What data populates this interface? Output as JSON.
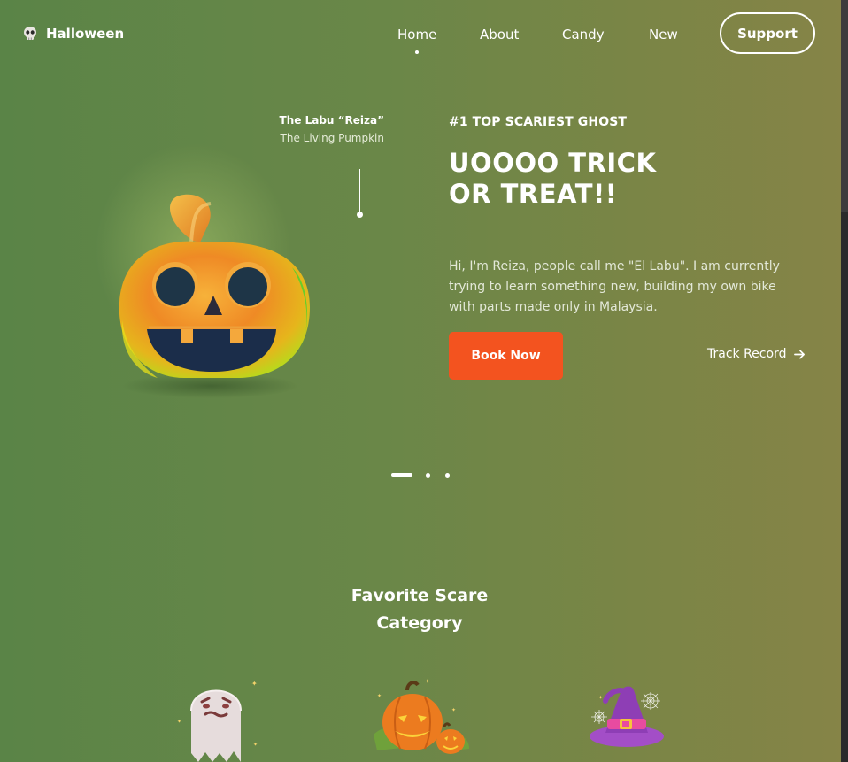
{
  "brand": {
    "name": "Halloween",
    "icon": "skull-icon"
  },
  "nav": {
    "items": [
      {
        "label": "Home",
        "active": true
      },
      {
        "label": "About",
        "active": false
      },
      {
        "label": "Candy",
        "active": false
      },
      {
        "label": "New",
        "active": false
      }
    ],
    "support_label": "Support"
  },
  "hero": {
    "caption_name": "The Labu “Reiza”",
    "caption_sub": "The Living Pumpkin",
    "eyebrow": "#1 TOP SCARIEST GHOST",
    "headline": "UOOOO TRICK OR TREAT!!",
    "intro": "Hi, I'm Reiza, people call me \"El Labu\". I am currently trying to learn something new, building my own bike with parts made only in Malaysia.",
    "book_label": "Book Now",
    "track_label": "Track Record",
    "image_icon": "jack-o-lantern-icon"
  },
  "slider": {
    "count": 3,
    "active_index": 0
  },
  "categories": {
    "title": "Favorite Scare Category",
    "items": [
      {
        "icon": "ghost-icon"
      },
      {
        "icon": "pumpkins-icon"
      },
      {
        "icon": "witch-hat-icon"
      }
    ]
  },
  "colors": {
    "accent": "#f3531f",
    "background_start": "#5a8447",
    "background_end": "#868447"
  }
}
